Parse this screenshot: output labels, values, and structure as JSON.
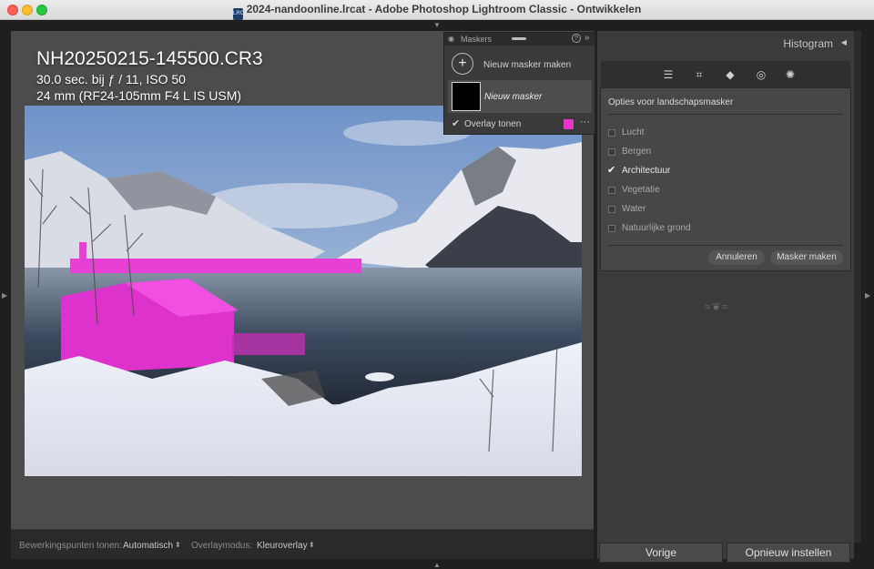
{
  "window": {
    "title": "2024-nandoonline.lrcat - Adobe Photoshop Lightroom Classic - Ontwikkelen",
    "doc_icon": "LRC",
    "colors": {
      "close": "#fe5f57",
      "minimize": "#febc2e",
      "maximize": "#28c840"
    }
  },
  "photo_info": {
    "filename": "NH20250215-145500.CR3",
    "exposure": "30.0 sec. bij ƒ / 11, ISO 50",
    "lens": "24 mm (RF24-105mm F4 L IS USM)"
  },
  "masks_panel": {
    "title": "Maskers",
    "help": "?",
    "collapse": "»",
    "new_mask": "Nieuw masker maken",
    "mask_name": "Nieuw masker",
    "overlay_checked": true,
    "overlay_label": "Overlay tonen",
    "overlay_color": "#ee33cc",
    "more": "···"
  },
  "right_panel": {
    "histogram_title": "Histogram",
    "tools": [
      "edit-sliders-icon",
      "crop-icon",
      "eraser-icon",
      "redeye-icon",
      "masking-icon"
    ],
    "landscape": {
      "title": "Opties voor landschapsmasker",
      "options": [
        {
          "label": "Lucht",
          "checked": false
        },
        {
          "label": "Bergen",
          "checked": false
        },
        {
          "label": "Architectuur",
          "checked": true
        },
        {
          "label": "Vegetatie",
          "checked": false
        },
        {
          "label": "Water",
          "checked": false
        },
        {
          "label": "Natuurlijke grond",
          "checked": false
        }
      ],
      "cancel": "Annuleren",
      "create": "Masker maken"
    },
    "previous": "Vorige",
    "reset": "Opnieuw instellen"
  },
  "toolbar": {
    "pins_label": "Bewerkingspunten tonen:",
    "pins_value": "Automatisch",
    "overlay_mode_label": "Overlaymodus:",
    "overlay_mode_value": "Kleuroverlay"
  }
}
